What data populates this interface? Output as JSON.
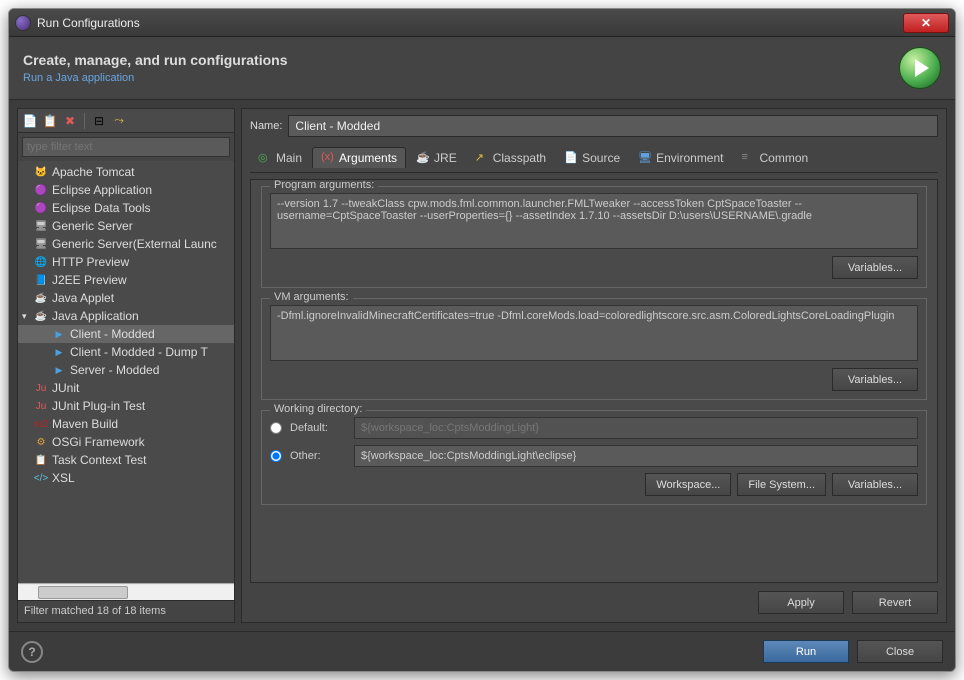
{
  "titlebar": {
    "title": "Run Configurations"
  },
  "header": {
    "title": "Create, manage, and run configurations",
    "subtitle": "Run a Java application"
  },
  "filter": {
    "placeholder": "type filter text",
    "status": "Filter matched 18 of 18 items"
  },
  "tree": {
    "items": [
      {
        "label": "Apache Tomcat",
        "icon": "tomcat"
      },
      {
        "label": "Eclipse Application",
        "icon": "eclipse"
      },
      {
        "label": "Eclipse Data Tools",
        "icon": "eclipse"
      },
      {
        "label": "Generic Server",
        "icon": "server"
      },
      {
        "label": "Generic Server(External Launc",
        "icon": "server"
      },
      {
        "label": "HTTP Preview",
        "icon": "http"
      },
      {
        "label": "J2EE Preview",
        "icon": "j2ee"
      },
      {
        "label": "Java Applet",
        "icon": "applet"
      },
      {
        "label": "Java Application",
        "icon": "java",
        "expanded": true,
        "children": [
          {
            "label": "Client - Modded",
            "icon": "run",
            "selected": true
          },
          {
            "label": "Client - Modded - Dump T",
            "icon": "run"
          },
          {
            "label": "Server - Modded",
            "icon": "run"
          }
        ]
      },
      {
        "label": "JUnit",
        "icon": "junit"
      },
      {
        "label": "JUnit Plug-in Test",
        "icon": "junit-plugin"
      },
      {
        "label": "Maven Build",
        "icon": "maven"
      },
      {
        "label": "OSGi Framework",
        "icon": "osgi"
      },
      {
        "label": "Task Context Test",
        "icon": "task"
      },
      {
        "label": "XSL",
        "icon": "xsl"
      }
    ]
  },
  "name": {
    "label": "Name:",
    "value": "Client - Modded"
  },
  "tabs": [
    {
      "label": "Main",
      "icon": "main"
    },
    {
      "label": "Arguments",
      "icon": "args",
      "active": true
    },
    {
      "label": "JRE",
      "icon": "jre"
    },
    {
      "label": "Classpath",
      "icon": "classpath"
    },
    {
      "label": "Source",
      "icon": "source"
    },
    {
      "label": "Environment",
      "icon": "env"
    },
    {
      "label": "Common",
      "icon": "common"
    }
  ],
  "programArgs": {
    "legend": "Program arguments:",
    "value": "--version 1.7 --tweakClass cpw.mods.fml.common.launcher.FMLTweaker --accessToken CptSpaceToaster --username=CptSpaceToaster --userProperties={} --assetIndex 1.7.10 --assetsDir D:\\users\\USERNAME\\.gradle",
    "variablesBtn": "Variables..."
  },
  "vmArgs": {
    "legend": "VM arguments:",
    "value": "-Dfml.ignoreInvalidMinecraftCertificates=true -Dfml.coreMods.load=coloredlightscore.src.asm.ColoredLightsCoreLoadingPlugin",
    "variablesBtn": "Variables..."
  },
  "workingDir": {
    "legend": "Working directory:",
    "defaultLabel": "Default:",
    "defaultValue": "${workspace_loc:CptsModdingLight}",
    "otherLabel": "Other:",
    "otherValue": "${workspace_loc:CptsModdingLight\\eclipse}",
    "workspaceBtn": "Workspace...",
    "fileSystemBtn": "File System...",
    "variablesBtn": "Variables..."
  },
  "buttons": {
    "apply": "Apply",
    "revert": "Revert",
    "run": "Run",
    "close": "Close"
  }
}
